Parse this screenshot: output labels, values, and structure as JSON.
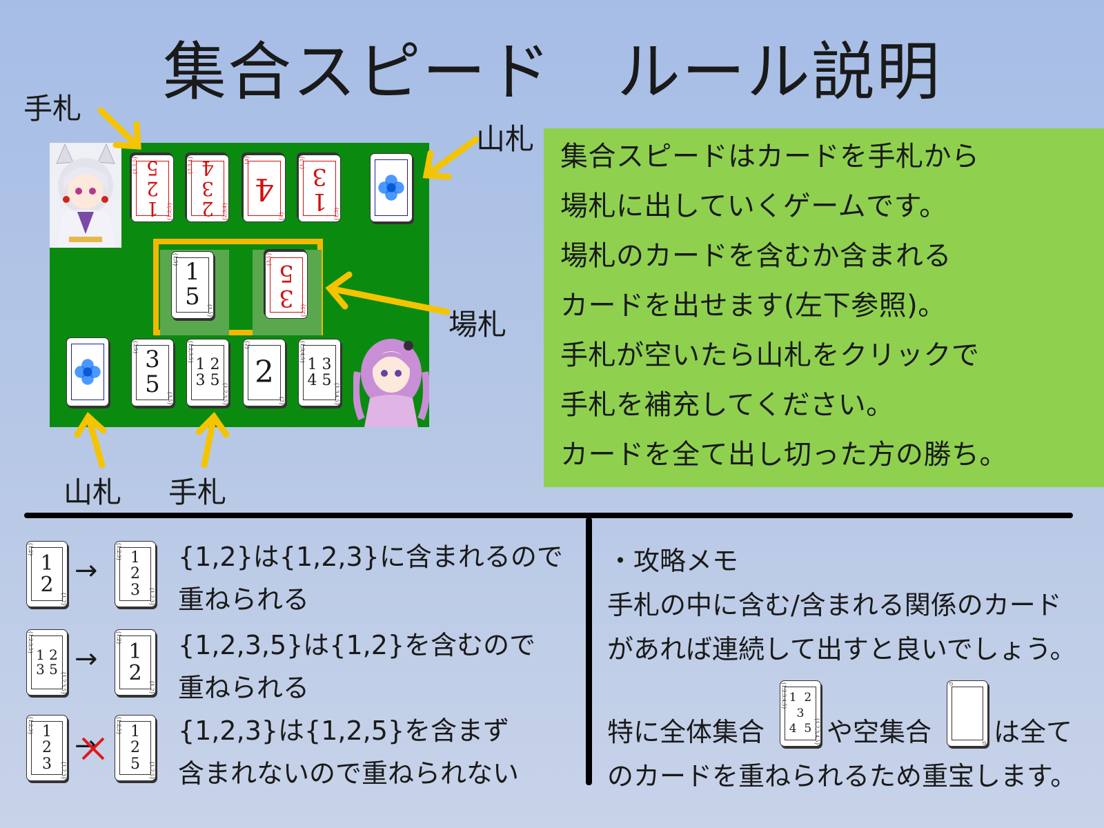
{
  "title": "集合スピード　ルール説明",
  "labels": {
    "hand_top": "手札",
    "deck_top": "山札",
    "field": "場札",
    "deck_bottom": "山札",
    "hand_bottom": "手札"
  },
  "board": {
    "opponent_hand": [
      {
        "digits": "1\n2\n5",
        "corner": "{1,2,5}"
      },
      {
        "digits": "2\n3\n4",
        "corner": "{2,3,4}"
      },
      {
        "digits": "4",
        "corner": "{4}"
      },
      {
        "digits": "1\n3",
        "corner": "{1,3}"
      }
    ],
    "field_cards": [
      {
        "digits": "1\n5",
        "corner": "{1,5}",
        "color": "black"
      },
      {
        "digits": "3\n5",
        "corner": "{3,5}",
        "color": "red"
      }
    ],
    "player_hand": [
      {
        "digits": "3\n5",
        "corner": "{3,5}"
      },
      {
        "digits": "1 2\n3 5",
        "corner": "{1,2,3,5}"
      },
      {
        "digits": "2",
        "corner": "{2}"
      },
      {
        "digits": "1 3\n4 5",
        "corner": "{1,3,4,5}"
      }
    ]
  },
  "info": {
    "lines": [
      "集合スピードはカードを手札から",
      "場札に出していくゲームです。",
      "場札のカードを含むか含まれる",
      "カードを出せます(左下参照)。",
      "手札が空いたら山札をクリックで",
      "手札を補充してください。",
      "カードを全て出し切った方の勝ち。"
    ]
  },
  "rules": [
    {
      "from": {
        "digits": "1\n2",
        "corner": "{1,2}"
      },
      "symbol": "→",
      "to": {
        "digits": "1\n2\n3",
        "corner": "{1,2,3}"
      },
      "line1": "{1,2}は{1,2,3}に含まれるので",
      "line2": "重ねられる",
      "allowed": true
    },
    {
      "from": {
        "digits": "1 2\n3 5",
        "corner": "{1,2,3,5}"
      },
      "symbol": "→",
      "to": {
        "digits": "1\n2",
        "corner": "{1,2}"
      },
      "line1": "{1,2,3,5}は{1,2}を含むので",
      "line2": "重ねられる",
      "allowed": true
    },
    {
      "from": {
        "digits": "1\n2\n3",
        "corner": "{1,2,3}"
      },
      "symbol": "→",
      "to": {
        "digits": "1\n2\n5",
        "corner": "{1,2,5}"
      },
      "line1": "{1,2,3}は{1,2,5}を含まず",
      "line2": "含まれないので重ねられない",
      "allowed": false
    }
  ],
  "tips": {
    "heading": "・攻略メモ",
    "line1": "手札の中に含む/含まれる関係のカード",
    "line2": "があれば連続して出すと良いでしょう。",
    "line3_a": "特に全体集合",
    "line3_b": "や空集合",
    "line3_c": "は全て",
    "line4": "のカードを重ねられるため重宝します。",
    "universal_card": {
      "digits": "1  2\n  3  \n4  5",
      "corner": "{1,2,3,4,5}"
    },
    "empty_card": {
      "digits": "",
      "corner": "∅"
    }
  },
  "colors": {
    "board": "#0b8a10",
    "highlight": "#f5b800",
    "info_bg": "#8fd14f",
    "red_card": "#d01010",
    "deck_flower": "#1e7fff"
  }
}
